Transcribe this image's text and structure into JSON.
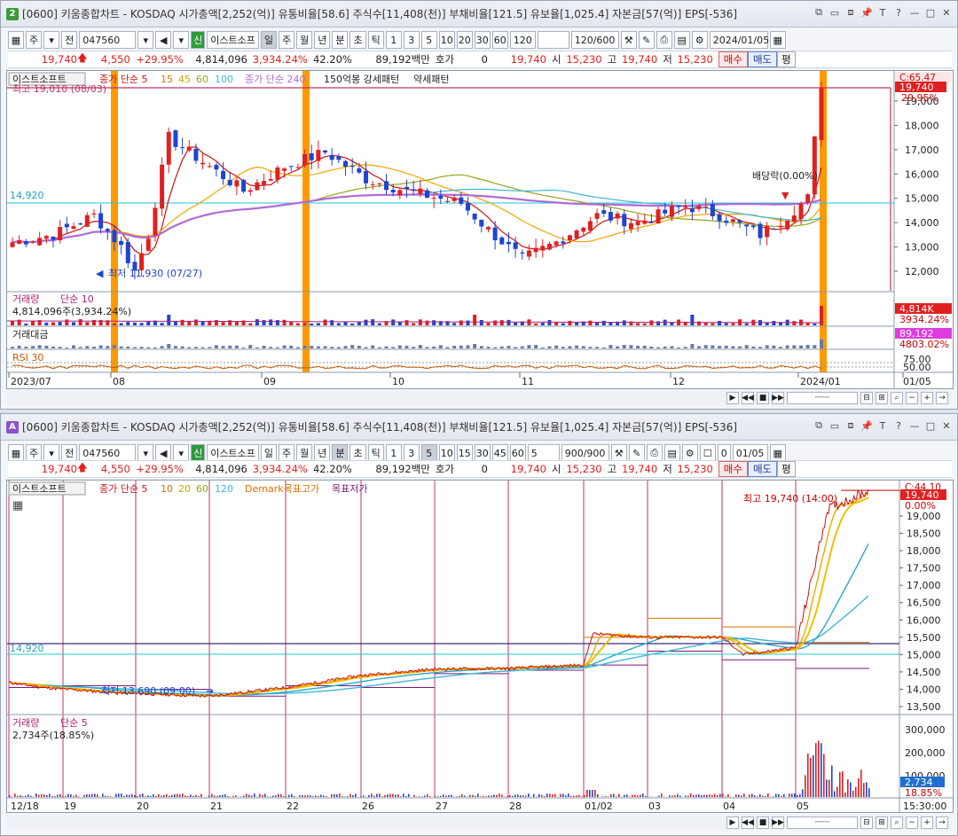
{
  "colors": {
    "up": "#e02020",
    "down": "#1e44d0",
    "ma5": "#cc1111",
    "ma15": "#f0a500",
    "ma45": "#9aa31a",
    "ma60": "#3fb6d6",
    "ma100": "#b06ad6",
    "spike": "#ff9900",
    "cyan": "#22c7d6"
  },
  "window1": {
    "badge": "2",
    "title": "[0600] 키움종합차트 - KOSDAQ 시가총액[2,252(억)] 유통비율[58.6] 주식수[11,408(천)] 부채비율[121.5] 유보율[1,025.4] 자본금[57(억)] EPS[-536]",
    "toolbar": {
      "period_btn": "주",
      "prev_btn": "전",
      "code": "047560",
      "new_btn": "신",
      "stock_name": "이스트소프",
      "periods": [
        "일",
        "주",
        "월",
        "년"
      ],
      "minute": "분",
      "tick_a": "초",
      "tick_b": "틱",
      "nums": [
        "1",
        "3",
        "5",
        "10",
        "20",
        "30",
        "60",
        "120"
      ],
      "count": "120/600",
      "date": "2024/01/05"
    },
    "info": {
      "price": "19,740",
      "change": "4,550",
      "rate": "+29.95%",
      "volume": "4,814,096",
      "vol_rate": "3,934.24%",
      "turnover": "42.20%",
      "amount": "89,192백만",
      "quote_label": "호가",
      "quote_val": "0",
      "cur": "19,740",
      "open_label": "시",
      "open": "15,230",
      "high_label": "고",
      "high": "19,740",
      "low_label": "저",
      "low": "15,230",
      "buy": "매수",
      "sell": "매도",
      "eval": "평"
    },
    "legend": {
      "name": "이스트소프트",
      "ma_label": "종가 단순 5",
      "ma_vals": [
        "15",
        "45",
        "60",
        "100"
      ],
      "ma2": "종가 단순 240",
      "pattern": "150억봉 강세패턴",
      "pattern2": "약세패턴"
    },
    "annot": {
      "high": "최고 19,010 (08/03)",
      "low": "최저 11,930 (07/27)",
      "div": "배당락(0.00%)",
      "hline": "14,920"
    },
    "price_axis": {
      "top": "C:65.47",
      "cur": "19,740",
      "pct": "29.95%",
      "ticks": [
        "19,000",
        "18,000",
        "17,000",
        "16,000",
        "15,000",
        "14,000",
        "13,000",
        "12,000"
      ]
    },
    "vol_panel": {
      "label": "거래량",
      "ma": "단순 10",
      "value": "4,814,096주(3,934.24%)",
      "axis_a": "4,814K",
      "axis_b": "3934.24%"
    },
    "amt_panel": {
      "label": "거래대금",
      "axis_a": "89,192",
      "axis_b": "4803.02%"
    },
    "rsi_panel": {
      "label": "RSI 30",
      "axis_a": "75.00",
      "axis_b": "50.00"
    },
    "dates": [
      "2023/07",
      "08",
      "09",
      "10",
      "11",
      "12",
      "2024/01",
      "01/05"
    ]
  },
  "window2": {
    "badge": "A",
    "title": "[0600] 키움종합차트 - KOSDAQ 시가총액[2,252(억)] 유통비율[58.6] 주식수[11,408(천)] 부채비율[121.5] 유보율[1,025.4] 자본금[57(억)] EPS[-536]",
    "toolbar": {
      "period_btn": "주",
      "prev_btn": "전",
      "code": "047560",
      "new_btn": "신",
      "stock_name": "이스트소프",
      "periods": [
        "일",
        "주",
        "월",
        "년"
      ],
      "minute": "분",
      "tick_a": "초",
      "tick_b": "틱",
      "nums": [
        "1",
        "3",
        "5",
        "10",
        "15",
        "30",
        "45",
        "60"
      ],
      "unit": "5",
      "count": "900/900",
      "chk": "0",
      "date": "01/05"
    },
    "info": {
      "price": "19,740",
      "change": "4,550",
      "rate": "+29.95%",
      "volume": "4,814,096",
      "vol_rate": "3,934.24%",
      "turnover": "42.20%",
      "amount": "89,192백만",
      "quote_label": "호가",
      "quote_val": "0",
      "cur": "19,740",
      "open_label": "시",
      "open": "15,230",
      "high_label": "고",
      "high": "19,740",
      "low_label": "저",
      "low": "15,230",
      "buy": "매수",
      "sell": "매도",
      "eval": "평"
    },
    "legend": {
      "name": "이스트소프트",
      "ma_label": "종가 단순 5",
      "ma_vals": [
        "10",
        "20",
        "60",
        "120"
      ],
      "demark": "Demark목표고가",
      "demark2": "목표저가"
    },
    "annot": {
      "high": "최고 19,740 (14:00)",
      "low": "최저 13,690 (09:00)",
      "hline": "14,920"
    },
    "price_axis": {
      "top": "C:44.10",
      "cur": "19,740",
      "pct": "0.00%",
      "ticks": [
        "19,000",
        "18,500",
        "18,000",
        "17,500",
        "17,000",
        "16,500",
        "16,000",
        "15,500",
        "15,000",
        "14,500",
        "14,000",
        "13,500"
      ]
    },
    "vol_panel": {
      "label": "거래량",
      "ma": "단순 5",
      "value": "2,734주(18.85%)",
      "ticks": [
        "300,000",
        "200,000",
        "100,000"
      ],
      "axis_a": "2,734",
      "axis_b": "18.85%"
    },
    "dates": [
      "12/18",
      "19",
      "20",
      "21",
      "22",
      "26",
      "27",
      "28",
      "01/02",
      "03",
      "04",
      "05"
    ],
    "time_label": "15:30:00"
  }
}
